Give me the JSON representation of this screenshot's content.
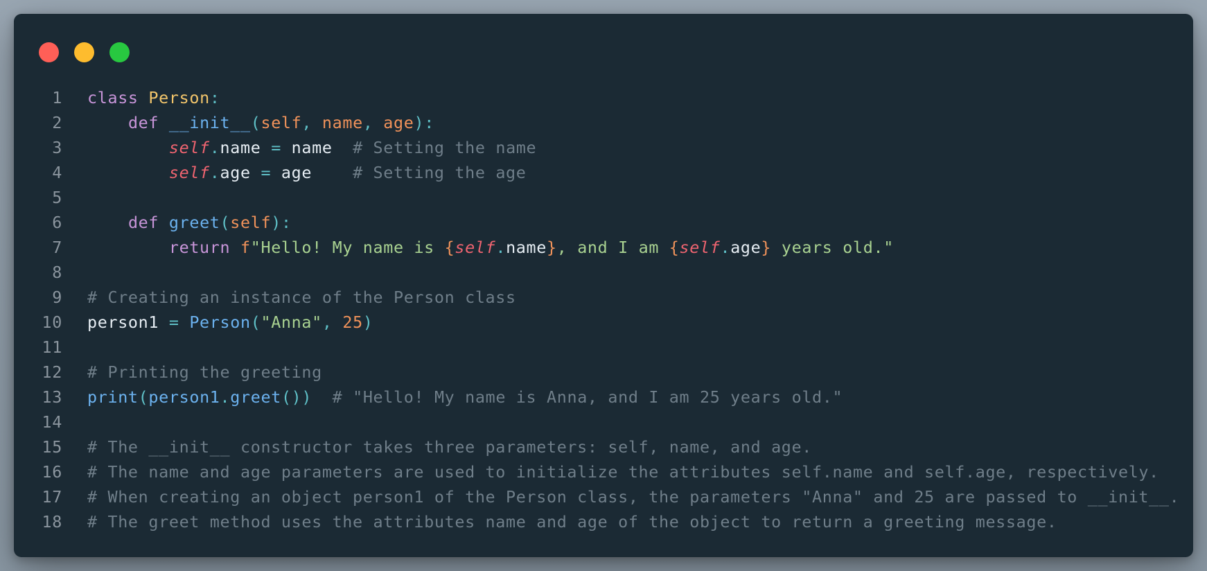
{
  "window": {
    "traffic_lights": [
      {
        "name": "close",
        "color": "#ff5f57"
      },
      {
        "name": "minimize",
        "color": "#febc2e"
      },
      {
        "name": "zoom",
        "color": "#28c840"
      }
    ]
  },
  "editor": {
    "language": "python",
    "colors": {
      "background": "#1b2a34",
      "keyword": "#c895d9",
      "class_name": "#f2c56b",
      "function": "#6cb2ef",
      "parameter": "#f0925a",
      "self": "#ef6470",
      "string": "#a9d291",
      "number": "#f0925a",
      "comment": "#6f7e89",
      "punctuation": "#5fc0c7",
      "line_number": "#8b959e"
    },
    "lines": [
      {
        "n": "1",
        "tokens": [
          {
            "t": "class",
            "c": "kw"
          },
          {
            "t": " ",
            "c": "var"
          },
          {
            "t": "Person",
            "c": "cls"
          },
          {
            "t": ":",
            "c": "pun"
          }
        ]
      },
      {
        "n": "2",
        "tokens": [
          {
            "t": "    ",
            "c": "var"
          },
          {
            "t": "def",
            "c": "kw"
          },
          {
            "t": " ",
            "c": "var"
          },
          {
            "t": "__init__",
            "c": "fn"
          },
          {
            "t": "(",
            "c": "pun"
          },
          {
            "t": "self",
            "c": "par"
          },
          {
            "t": ", ",
            "c": "pun"
          },
          {
            "t": "name",
            "c": "par"
          },
          {
            "t": ", ",
            "c": "pun"
          },
          {
            "t": "age",
            "c": "par"
          },
          {
            "t": "):",
            "c": "pun"
          }
        ]
      },
      {
        "n": "3",
        "tokens": [
          {
            "t": "        ",
            "c": "var"
          },
          {
            "t": "self",
            "c": "slf"
          },
          {
            "t": ".",
            "c": "pun"
          },
          {
            "t": "name",
            "c": "var"
          },
          {
            "t": " ",
            "c": "var"
          },
          {
            "t": "=",
            "c": "pun"
          },
          {
            "t": " name  ",
            "c": "var"
          },
          {
            "t": "# Setting the name",
            "c": "com"
          }
        ]
      },
      {
        "n": "4",
        "tokens": [
          {
            "t": "        ",
            "c": "var"
          },
          {
            "t": "self",
            "c": "slf"
          },
          {
            "t": ".",
            "c": "pun"
          },
          {
            "t": "age",
            "c": "var"
          },
          {
            "t": " ",
            "c": "var"
          },
          {
            "t": "=",
            "c": "pun"
          },
          {
            "t": " age    ",
            "c": "var"
          },
          {
            "t": "# Setting the age",
            "c": "com"
          }
        ]
      },
      {
        "n": "5",
        "tokens": []
      },
      {
        "n": "6",
        "tokens": [
          {
            "t": "    ",
            "c": "var"
          },
          {
            "t": "def",
            "c": "kw"
          },
          {
            "t": " ",
            "c": "var"
          },
          {
            "t": "greet",
            "c": "fn"
          },
          {
            "t": "(",
            "c": "pun"
          },
          {
            "t": "self",
            "c": "par"
          },
          {
            "t": "):",
            "c": "pun"
          }
        ]
      },
      {
        "n": "7",
        "tokens": [
          {
            "t": "        ",
            "c": "var"
          },
          {
            "t": "return",
            "c": "kw"
          },
          {
            "t": " ",
            "c": "var"
          },
          {
            "t": "f",
            "c": "par"
          },
          {
            "t": "\"Hello! My name is ",
            "c": "str"
          },
          {
            "t": "{",
            "c": "br"
          },
          {
            "t": "self",
            "c": "slf"
          },
          {
            "t": ".",
            "c": "pun"
          },
          {
            "t": "name",
            "c": "var"
          },
          {
            "t": "}",
            "c": "br"
          },
          {
            "t": ", and I am ",
            "c": "str"
          },
          {
            "t": "{",
            "c": "br"
          },
          {
            "t": "self",
            "c": "slf"
          },
          {
            "t": ".",
            "c": "pun"
          },
          {
            "t": "age",
            "c": "var"
          },
          {
            "t": "}",
            "c": "br"
          },
          {
            "t": " years old.\"",
            "c": "str"
          }
        ]
      },
      {
        "n": "8",
        "tokens": []
      },
      {
        "n": "9",
        "tokens": [
          {
            "t": "# Creating an instance of the Person class",
            "c": "com"
          }
        ]
      },
      {
        "n": "10",
        "tokens": [
          {
            "t": "person1 ",
            "c": "var"
          },
          {
            "t": "=",
            "c": "pun"
          },
          {
            "t": " ",
            "c": "var"
          },
          {
            "t": "Person",
            "c": "fn"
          },
          {
            "t": "(",
            "c": "pun"
          },
          {
            "t": "\"Anna\"",
            "c": "str"
          },
          {
            "t": ", ",
            "c": "pun"
          },
          {
            "t": "25",
            "c": "num"
          },
          {
            "t": ")",
            "c": "pun"
          }
        ]
      },
      {
        "n": "11",
        "tokens": []
      },
      {
        "n": "12",
        "tokens": [
          {
            "t": "# Printing the greeting",
            "c": "com"
          }
        ]
      },
      {
        "n": "13",
        "tokens": [
          {
            "t": "print",
            "c": "fn"
          },
          {
            "t": "(",
            "c": "pun"
          },
          {
            "t": "person1",
            "c": "fn"
          },
          {
            "t": ".",
            "c": "pun"
          },
          {
            "t": "greet",
            "c": "fn"
          },
          {
            "t": "())",
            "c": "pun"
          },
          {
            "t": "  ",
            "c": "var"
          },
          {
            "t": "# \"Hello! My name is Anna, and I am 25 years old.\"",
            "c": "com"
          }
        ]
      },
      {
        "n": "14",
        "tokens": []
      },
      {
        "n": "15",
        "tokens": [
          {
            "t": "# The __init__ constructor takes three parameters: self, name, and age.",
            "c": "com"
          }
        ]
      },
      {
        "n": "16",
        "tokens": [
          {
            "t": "# The name and age parameters are used to initialize the attributes self.name and self.age, respectively.",
            "c": "com"
          }
        ]
      },
      {
        "n": "17",
        "tokens": [
          {
            "t": "# When creating an object person1 of the Person class, the parameters \"Anna\" and 25 are passed to __init__.",
            "c": "com"
          }
        ]
      },
      {
        "n": "18",
        "tokens": [
          {
            "t": "# The greet method uses the attributes name and age of the object to return a greeting message.",
            "c": "com"
          }
        ]
      }
    ]
  }
}
